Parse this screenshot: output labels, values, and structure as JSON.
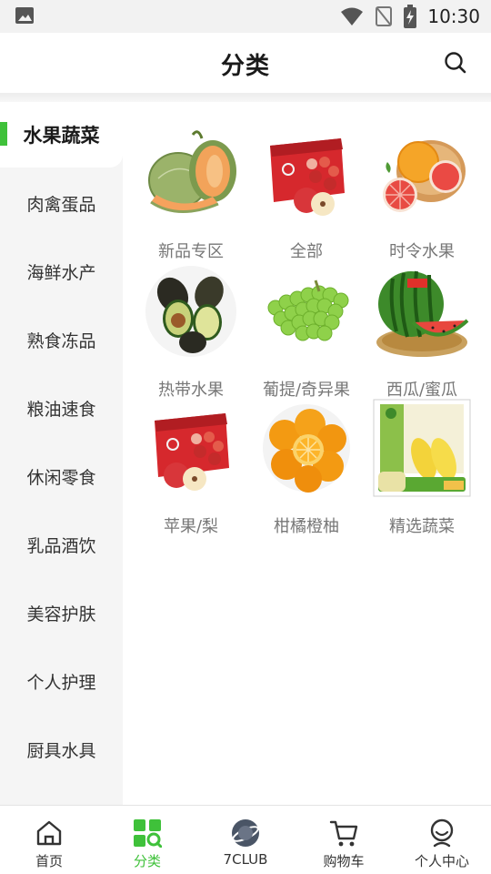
{
  "status_bar": {
    "time": "10:30"
  },
  "header": {
    "title": "分类"
  },
  "sidebar": {
    "items": [
      {
        "label": "水果蔬菜",
        "active": true
      },
      {
        "label": "肉禽蛋品"
      },
      {
        "label": "海鲜水产"
      },
      {
        "label": "熟食冻品"
      },
      {
        "label": "粮油速食"
      },
      {
        "label": "休闲零食"
      },
      {
        "label": "乳品酒饮"
      },
      {
        "label": "美容护肤"
      },
      {
        "label": "个人护理"
      },
      {
        "label": "厨具水具"
      }
    ]
  },
  "categories": [
    {
      "label": "新品专区",
      "icon": "melon-image"
    },
    {
      "label": "全部",
      "icon": "apple-box-image"
    },
    {
      "label": "时令水果",
      "icon": "grapefruit-image"
    },
    {
      "label": "热带水果",
      "icon": "avocado-image"
    },
    {
      "label": "葡提/奇异果",
      "icon": "grapes-image"
    },
    {
      "label": "西瓜/蜜瓜",
      "icon": "watermelon-image"
    },
    {
      "label": "苹果/梨",
      "icon": "apple-box-image"
    },
    {
      "label": "柑橘橙柚",
      "icon": "orange-image"
    },
    {
      "label": "精选蔬菜",
      "icon": "corn-box-image"
    }
  ],
  "bottom_nav": {
    "items": [
      {
        "label": "首页",
        "icon": "home-icon"
      },
      {
        "label": "分类",
        "icon": "category-icon",
        "active": true
      },
      {
        "label": "7CLUB",
        "icon": "planet-icon"
      },
      {
        "label": "购物车",
        "icon": "cart-icon"
      },
      {
        "label": "个人中心",
        "icon": "profile-icon"
      }
    ]
  },
  "colors": {
    "accent": "#3fc13a",
    "sidebar_bg": "#f5f5f5",
    "label_gray": "#777777"
  }
}
